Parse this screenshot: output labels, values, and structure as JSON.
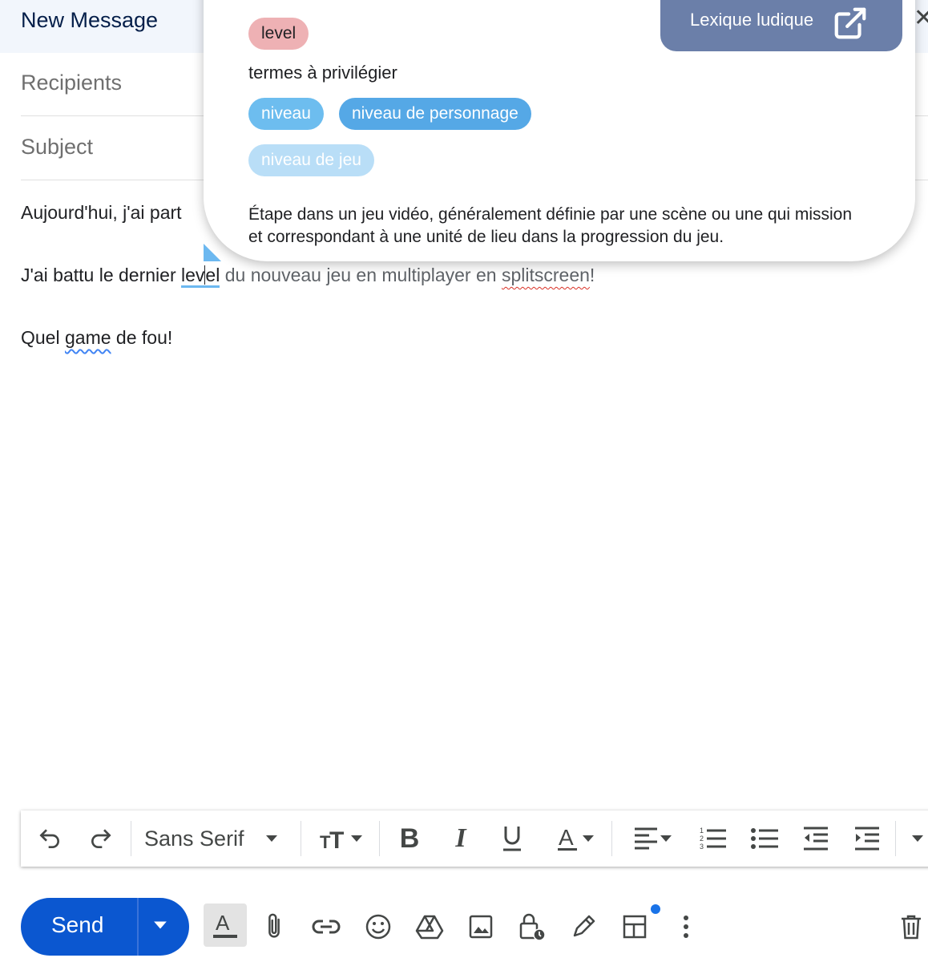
{
  "window": {
    "title": "New Message"
  },
  "fields": {
    "recipients": "Recipients",
    "subject": "Subject"
  },
  "body": {
    "line1": "Aujourd'hui, j'ai part",
    "line2": {
      "before": "J'ai battu le dernier ",
      "word_a": "lev",
      "word_b": "el",
      "mid": " du nouveau jeu en multiplayer en ",
      "underlined": "splitscreen",
      "end": "!"
    },
    "line3": {
      "before": "Quel ",
      "underlined": "game",
      "after": " de fou!"
    }
  },
  "popup": {
    "term": "level",
    "preferred_label": "termes à privilégier",
    "suggestions": [
      "niveau",
      "niveau de personnage",
      "niveau de jeu"
    ],
    "definition": "Étape dans un jeu vidéo, généralement définie par une scène ou une qui mission et correspondant à une unité de lieu dans la progression du jeu.",
    "lexique_button": "Lexique ludique",
    "colors": {
      "term_chip": "#eeb1b4",
      "suggestion": "#55a8e6",
      "button": "#6b7fa9"
    }
  },
  "toolbar": {
    "font": "Sans Serif"
  },
  "footer": {
    "send": "Send"
  },
  "colors": {
    "send": "#0b57d0",
    "header_bg": "#f2f6fc"
  }
}
